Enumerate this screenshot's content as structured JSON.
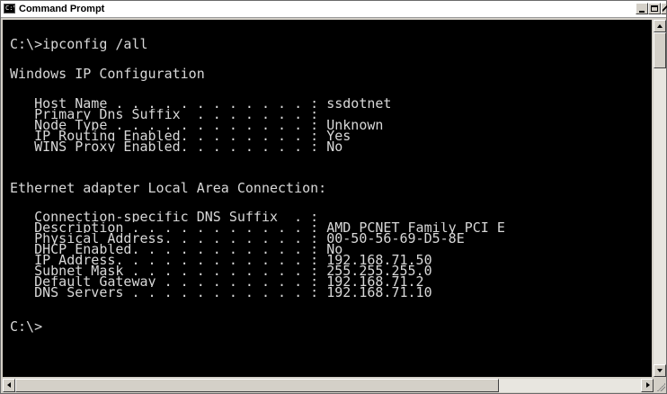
{
  "window": {
    "title": "Command Prompt",
    "icon": "console-icon",
    "icon_text": "C:\\"
  },
  "titlebar_controls": {
    "minimize_icon": "minimize-icon",
    "maximize_icon": "maximize-icon",
    "close_icon": "close-icon"
  },
  "console": {
    "lines": [
      "C:\\>ipconfig /all",
      "Windows IP Configuration",
      "   Host Name . . . . . . . . . . . . : ssdotnet",
      "   Primary Dns Suffix  . . . . . . . :",
      "   Node Type . . . . . . . . . . . . : Unknown",
      "   IP Routing Enabled. . . . . . . . : Yes",
      "   WINS Proxy Enabled. . . . . . . . : No",
      "Ethernet adapter Local Area Connection:",
      "   Connection-specific DNS Suffix  . :",
      "   Description . . . . . . . . . . . : AMD PCNET Family PCI E",
      "   Physical Address. . . . . . . . . : 00-50-56-69-D5-8E",
      "   DHCP Enabled. . . . . . . . . . . : No",
      "   IP Address. . . . . . . . . . . . : 192.168.71.50",
      "   Subnet Mask . . . . . . . . . . . : 255.255.255.0",
      "   Default Gateway . . . . . . . . . : 192.168.71.2",
      "   DNS Servers . . . . . . . . . . . : 192.168.71.10",
      "C:\\>"
    ],
    "text_color": "#d8d8d8",
    "background_color": "#000000"
  },
  "scrollbars": {
    "up_icon": "arrow-up-icon",
    "down_icon": "arrow-down-icon",
    "left_icon": "arrow-left-icon",
    "right_icon": "arrow-right-icon"
  }
}
